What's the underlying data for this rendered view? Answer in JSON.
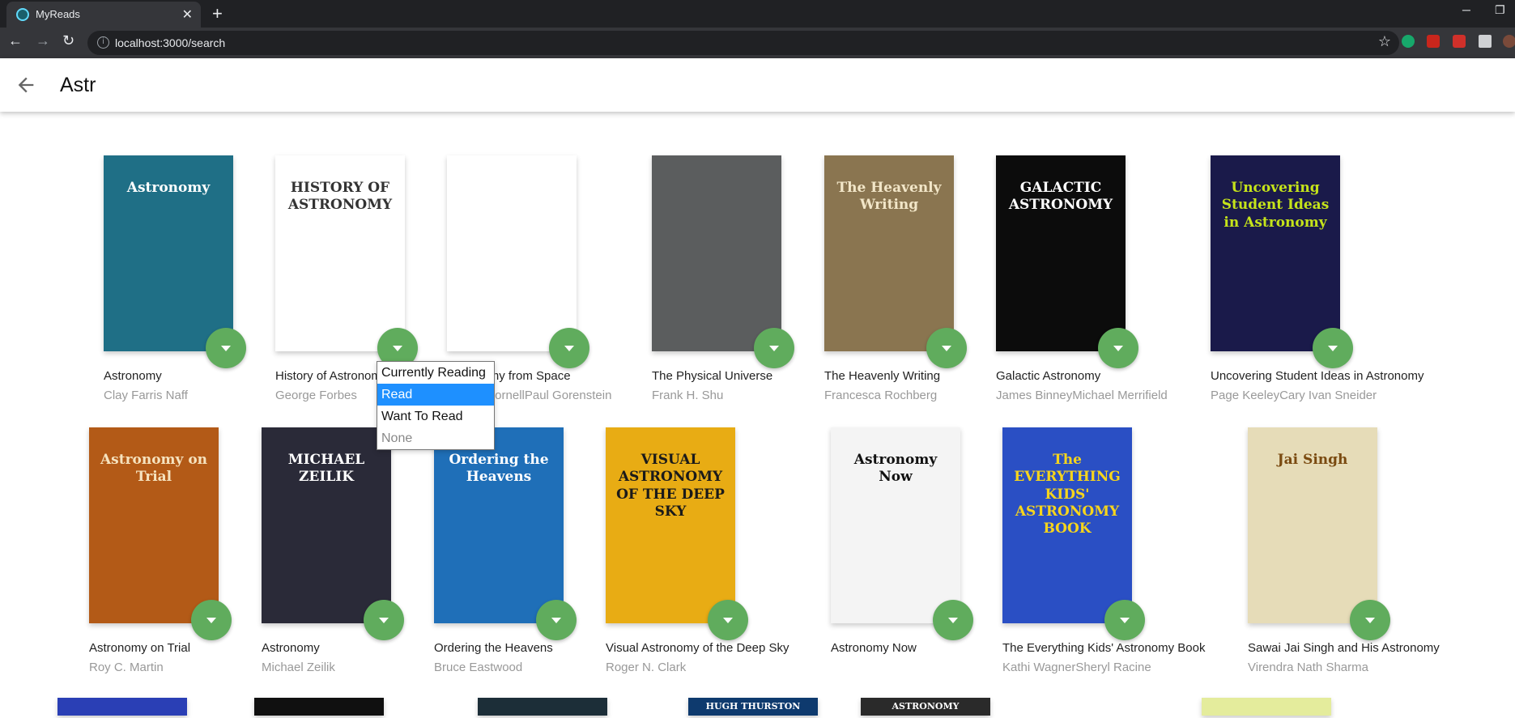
{
  "browser": {
    "tab_title": "MyReads",
    "tab_close": "✕",
    "new_tab": "+",
    "url": "localhost:3000/search",
    "minimize": "─",
    "restore": "❐",
    "back": "←",
    "forward": "→",
    "reload": "↻",
    "star": "☆"
  },
  "search": {
    "query": "Astr"
  },
  "books": [
    {
      "title": "Astronomy",
      "authors": "Clay Farris Naff",
      "cover": {
        "bg": "#1f6f86",
        "fg": "#ffffff",
        "text": "Astronomy"
      }
    },
    {
      "title": "History of Astronomy",
      "authors": "George Forbes",
      "cover": {
        "bg": "#ffffff",
        "fg": "#333333",
        "text": "HISTORY OF ASTRONOMY"
      }
    },
    {
      "title": "Astronomy from Space",
      "authors": "James CornellPaul Gorenstein",
      "cover": {
        "bg": "#ffffff",
        "fg": "#555555",
        "text": ""
      }
    },
    {
      "title": "The Physical Universe",
      "authors": "Frank H. Shu",
      "cover": {
        "bg": "#5b5d5e",
        "fg": "#4aa3c9",
        "text": ""
      }
    },
    {
      "title": "The Heavenly Writing",
      "authors": "Francesca Rochberg",
      "cover": {
        "bg": "#8a7550",
        "fg": "#f2e6c8",
        "text": "The Heavenly Writing"
      }
    },
    {
      "title": "Galactic Astronomy",
      "authors": "James BinneyMichael Merrifield",
      "cover": {
        "bg": "#0c0c0c",
        "fg": "#ffffff",
        "text": "GALACTIC ASTRONOMY"
      }
    },
    {
      "title": "Uncovering Student Ideas in Astronomy",
      "authors": "Page KeeleyCary Ivan Sneider",
      "cover": {
        "bg": "#1a1a4a",
        "fg": "#c5e31a",
        "text": "Uncovering Student Ideas in Astronomy"
      }
    },
    {
      "title": "Astronomy on Trial",
      "authors": "Roy C. Martin",
      "cover": {
        "bg": "#b35a17",
        "fg": "#f6e3bf",
        "text": "Astronomy on Trial"
      }
    },
    {
      "title": "Astronomy",
      "authors": "Michael Zeilik",
      "cover": {
        "bg": "#2a2a38",
        "fg": "#ffffff",
        "text": "MICHAEL ZEILIK"
      }
    },
    {
      "title": "Ordering the Heavens",
      "authors": "Bruce Eastwood",
      "cover": {
        "bg": "#1f6fb8",
        "fg": "#ffffff",
        "text": "Ordering the Heavens"
      }
    },
    {
      "title": "Visual Astronomy of the Deep Sky",
      "authors": "Roger N. Clark",
      "cover": {
        "bg": "#e8ac14",
        "fg": "#1a1a1a",
        "text": "VISUAL ASTRONOMY OF THE DEEP SKY"
      }
    },
    {
      "title": "Astronomy Now",
      "authors": "",
      "cover": {
        "bg": "#f4f4f4",
        "fg": "#111111",
        "text": "Astronomy Now"
      }
    },
    {
      "title": "The Everything Kids' Astronomy Book",
      "authors": "Kathi WagnerSheryl Racine",
      "cover": {
        "bg": "#2a4fc4",
        "fg": "#f7d51c",
        "text": "The EVERYTHING KIDS' ASTRONOMY BOOK"
      }
    },
    {
      "title": "Sawai Jai Singh and His Astronomy",
      "authors": "Virendra Nath Sharma",
      "cover": {
        "bg": "#e6dcb8",
        "fg": "#7a4a10",
        "text": "Jai Singh"
      }
    },
    {
      "title": "",
      "authors": "",
      "cover": {
        "bg": "#2a3fb5",
        "fg": "#ffffff",
        "text": ""
      }
    },
    {
      "title": "",
      "authors": "",
      "cover": {
        "bg": "#101010",
        "fg": "#ffffff",
        "text": ""
      }
    },
    {
      "title": "",
      "authors": "",
      "cover": {
        "bg": "#1c2e38",
        "fg": "#ffffff",
        "text": ""
      }
    },
    {
      "title": "",
      "authors": "",
      "cover": {
        "bg": "#0e3a6e",
        "fg": "#ffffff",
        "text": "HUGH THURSTON"
      }
    },
    {
      "title": "",
      "authors": "",
      "cover": {
        "bg": "#2a2a2a",
        "fg": "#ffffff",
        "text": "ASTRONOMY"
      }
    },
    {
      "title": "",
      "authors": "",
      "cover": {
        "bg": "#e4ec9c",
        "fg": "#1a4a8a",
        "text": ""
      }
    }
  ],
  "shelf_menu": {
    "options": [
      "Currently Reading",
      "Read",
      "Want To Read",
      "None"
    ],
    "selected": "Read"
  },
  "colors": {
    "shelf_button": "#60ac5d",
    "selected_option": "#1e90ff"
  }
}
